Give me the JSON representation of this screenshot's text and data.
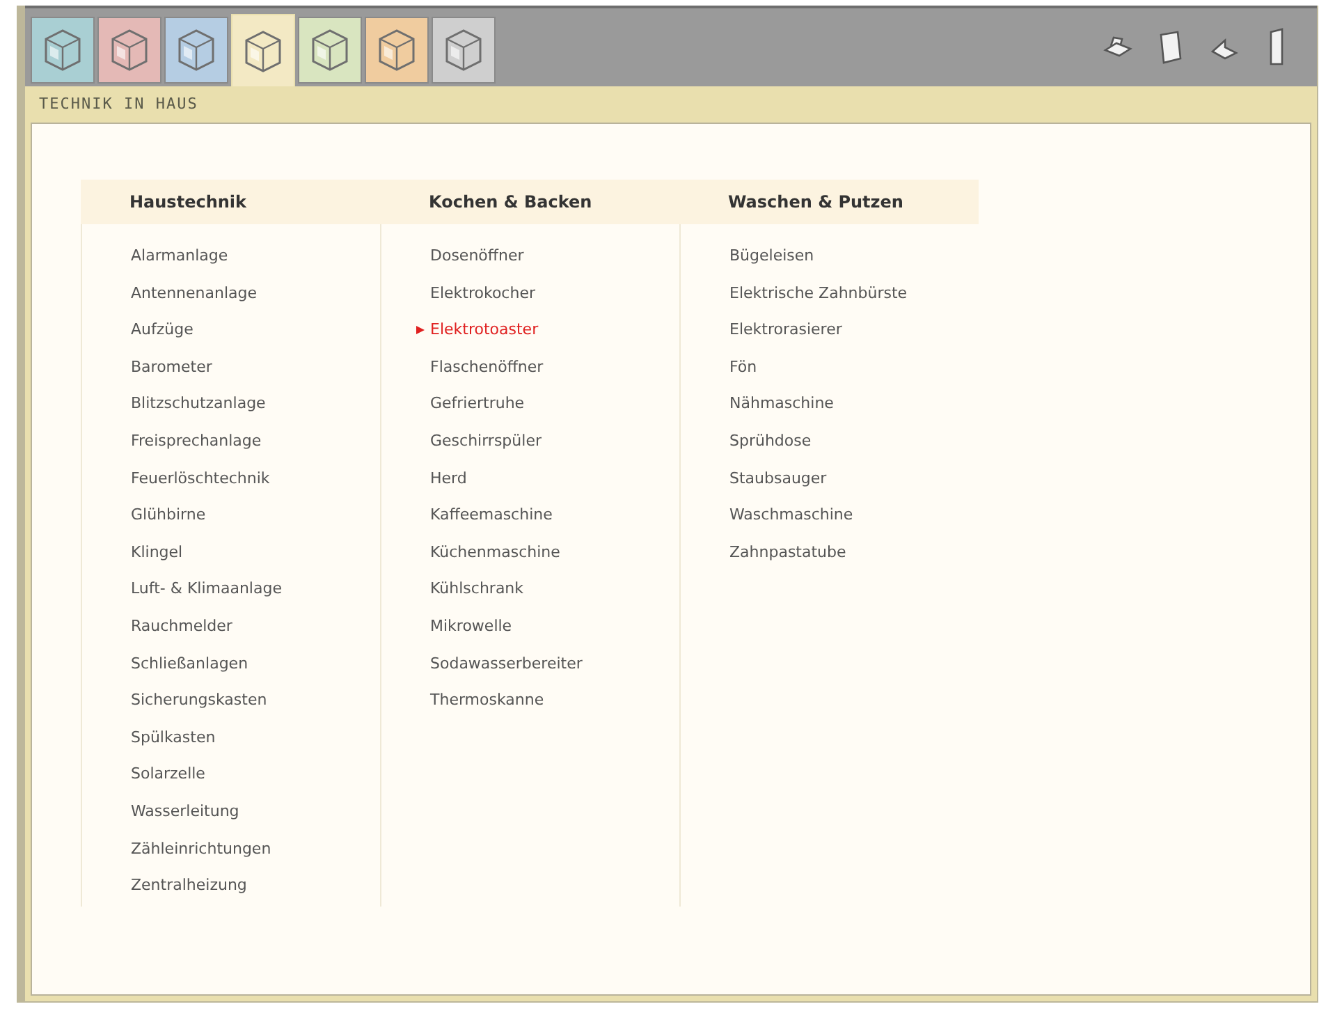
{
  "tabs": [
    {
      "color": "#a9cfd3",
      "selected": false
    },
    {
      "color": "#e4b9b6",
      "selected": false
    },
    {
      "color": "#b5cde3",
      "selected": false
    },
    {
      "color": "#f3e9c4",
      "selected": true
    },
    {
      "color": "#d9e5c0",
      "selected": false
    },
    {
      "color": "#f0cc9f",
      "selected": false
    },
    {
      "color": "#cfcfcf",
      "selected": false
    }
  ],
  "title": "TECHNIK IN HAUS",
  "columns": [
    {
      "heading": "Haustechnik",
      "items": [
        {
          "label": "Alarmanlage",
          "selected": false
        },
        {
          "label": "Antennenanlage",
          "selected": false
        },
        {
          "label": "Aufzüge",
          "selected": false
        },
        {
          "label": "Barometer",
          "selected": false
        },
        {
          "label": "Blitzschutzanlage",
          "selected": false
        },
        {
          "label": "Freisprechanlage",
          "selected": false
        },
        {
          "label": "Feuerlöschtechnik",
          "selected": false
        },
        {
          "label": "Glühbirne",
          "selected": false
        },
        {
          "label": "Klingel",
          "selected": false
        },
        {
          "label": "Luft- & Klimaanlage",
          "selected": false
        },
        {
          "label": "Rauchmelder",
          "selected": false
        },
        {
          "label": "Schließanlagen",
          "selected": false
        },
        {
          "label": "Sicherungskasten",
          "selected": false
        },
        {
          "label": "Spülkasten",
          "selected": false
        },
        {
          "label": "Solarzelle",
          "selected": false
        },
        {
          "label": "Wasserleitung",
          "selected": false
        },
        {
          "label": "Zähleinrichtungen",
          "selected": false
        },
        {
          "label": "Zentralheizung",
          "selected": false
        }
      ]
    },
    {
      "heading": "Kochen & Backen",
      "items": [
        {
          "label": "Dosenöffner",
          "selected": false
        },
        {
          "label": "Elektrokocher",
          "selected": false
        },
        {
          "label": "Elektrotoaster",
          "selected": true
        },
        {
          "label": "Flaschenöffner",
          "selected": false
        },
        {
          "label": "Gefriertruhe",
          "selected": false
        },
        {
          "label": "Geschirrspüler",
          "selected": false
        },
        {
          "label": "Herd",
          "selected": false
        },
        {
          "label": "Kaffeemaschine",
          "selected": false
        },
        {
          "label": "Küchenmaschine",
          "selected": false
        },
        {
          "label": "Kühlschrank",
          "selected": false
        },
        {
          "label": "Mikrowelle",
          "selected": false
        },
        {
          "label": "Sodawasserbereiter",
          "selected": false
        },
        {
          "label": "Thermoskanne",
          "selected": false
        }
      ]
    },
    {
      "heading": "Waschen & Putzen",
      "items": [
        {
          "label": "Bügeleisen",
          "selected": false
        },
        {
          "label": "Elektrische Zahnbürste",
          "selected": false
        },
        {
          "label": "Elektrorasierer",
          "selected": false
        },
        {
          "label": "Fön",
          "selected": false
        },
        {
          "label": "Nähmaschine",
          "selected": false
        },
        {
          "label": "Sprühdose",
          "selected": false
        },
        {
          "label": "Staubsauger",
          "selected": false
        },
        {
          "label": "Waschmaschine",
          "selected": false
        },
        {
          "label": "Zahnpastatube",
          "selected": false
        }
      ]
    }
  ]
}
